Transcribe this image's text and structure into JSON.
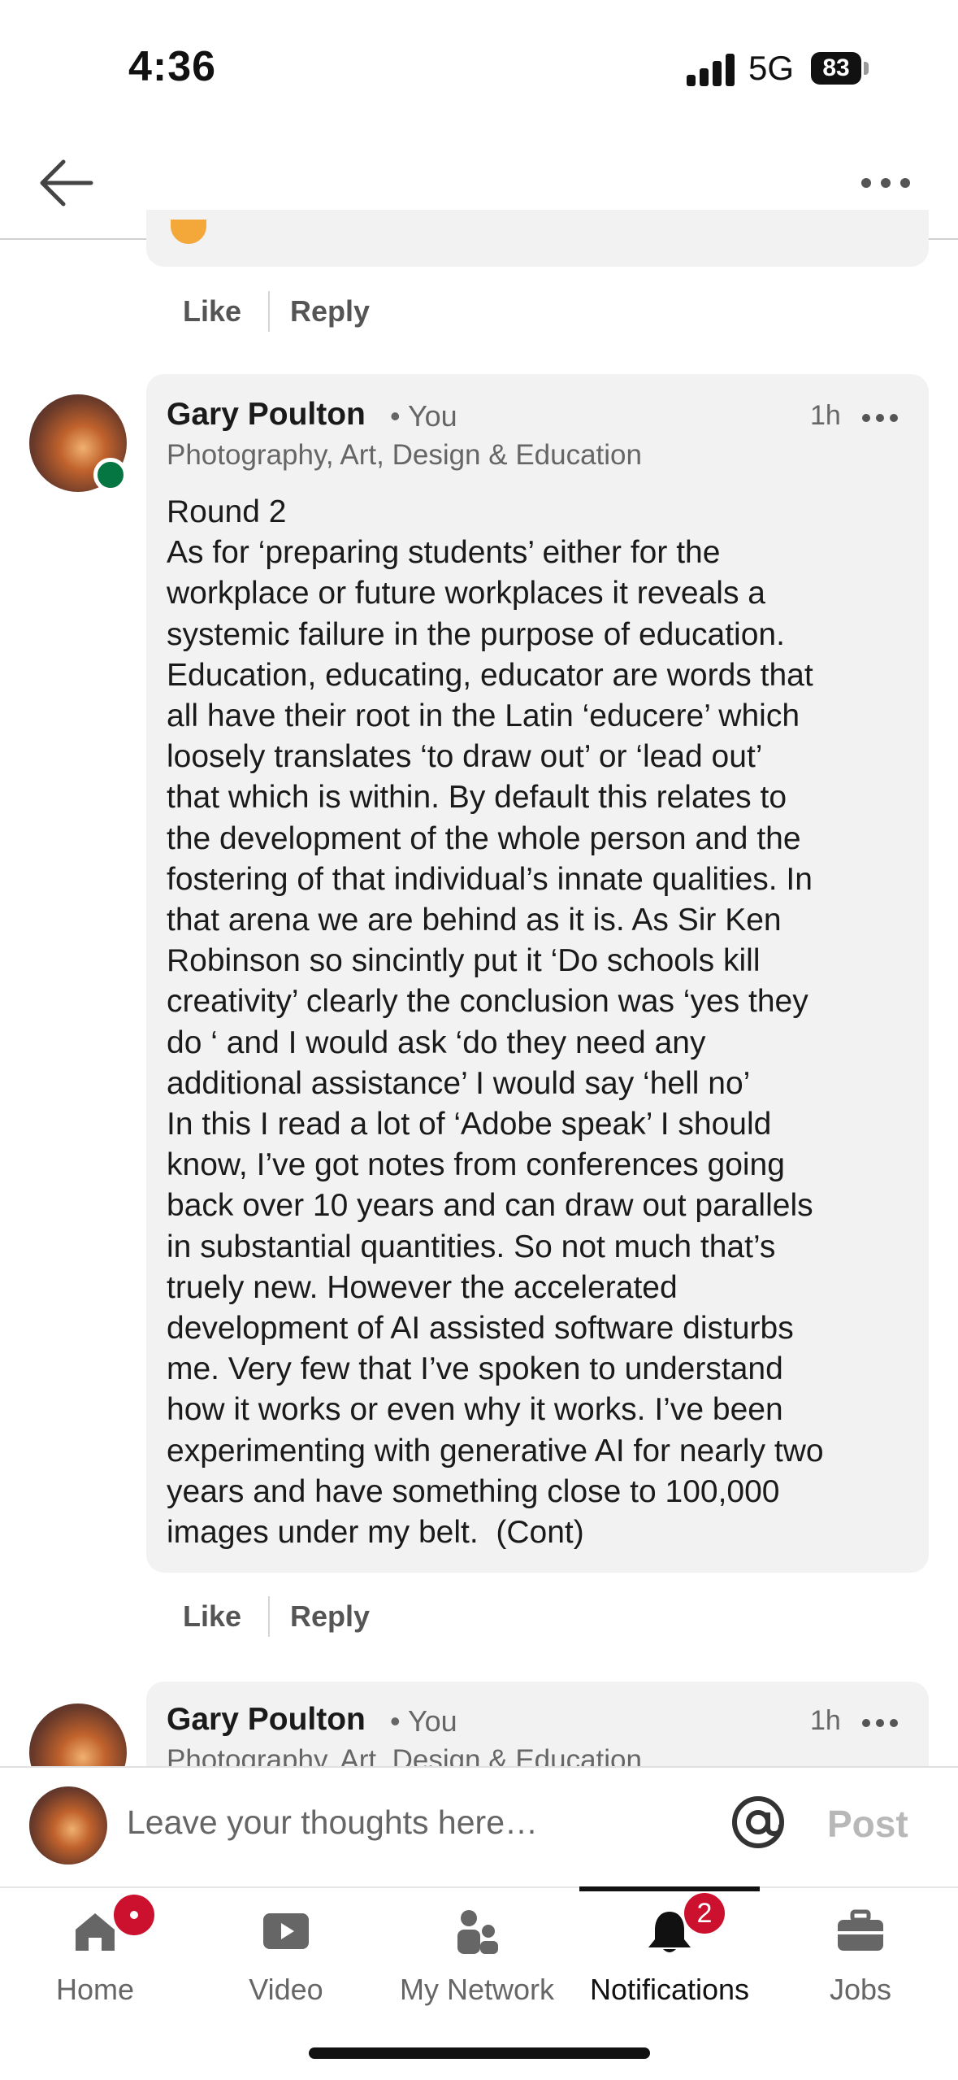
{
  "status_bar": {
    "time": "4:36",
    "network": "5G",
    "battery": "83"
  },
  "previous_comment": {
    "like_label": "Like",
    "reply_label": "Reply"
  },
  "comment": {
    "author": "Gary Poulton",
    "you_label": "• You",
    "headline": "Photography, Art, Design & Education",
    "time": "1h",
    "body": "Round 2\nAs for ‘preparing students’ either for the\nworkplace or future workplaces it reveals a\nsystemic failure in the purpose of education.\nEducation, educating, educator are words that\nall have their root in the Latin ‘educere’ which\nloosely translates ‘to draw out’ or ‘lead out’\nthat which is within. By default this relates to\nthe development of the whole person and the\nfostering of that individual’s innate qualities. In\nthat arena we are behind as it is. As Sir Ken\nRobinson so sincintly put it ‘Do schools kill\ncreativity’ clearly the conclusion was ‘yes they\ndo ‘ and I would ask ‘do they need any\nadditional assistance’ I would say ‘hell no’\nIn this I read a lot of ‘Adobe speak’ I should\nknow, I’ve got notes from conferences going\nback over 10 years and can draw out parallels\nin substantial quantities. So not much that’s\ntruely new. However the accelerated\ndevelopment of AI assisted software disturbs\nme. Very few that I’ve spoken to understand\nhow it works or even why it works. I’ve been\nexperimenting with generative AI for nearly two\nyears and have something close to 100,000\nimages under my belt.  (Cont)",
    "like_label": "Like",
    "reply_label": "Reply"
  },
  "next_comment": {
    "author": "Gary Poulton",
    "you_label": "• You",
    "headline": "Photography, Art, Design & Education",
    "time": "1h"
  },
  "compose": {
    "placeholder": "Leave your thoughts here…",
    "post_label": "Post"
  },
  "bottom_nav": {
    "items": [
      {
        "label": "Home",
        "icon": "home-icon",
        "badge": ""
      },
      {
        "label": "Video",
        "icon": "video-icon"
      },
      {
        "label": "My Network",
        "icon": "network-icon"
      },
      {
        "label": "Notifications",
        "icon": "bell-icon",
        "badge": "2",
        "active": true
      },
      {
        "label": "Jobs",
        "icon": "briefcase-icon"
      }
    ]
  },
  "colors": {
    "online": "#057642",
    "badge": "#cb112d",
    "bubble": "#f2f2f2"
  }
}
